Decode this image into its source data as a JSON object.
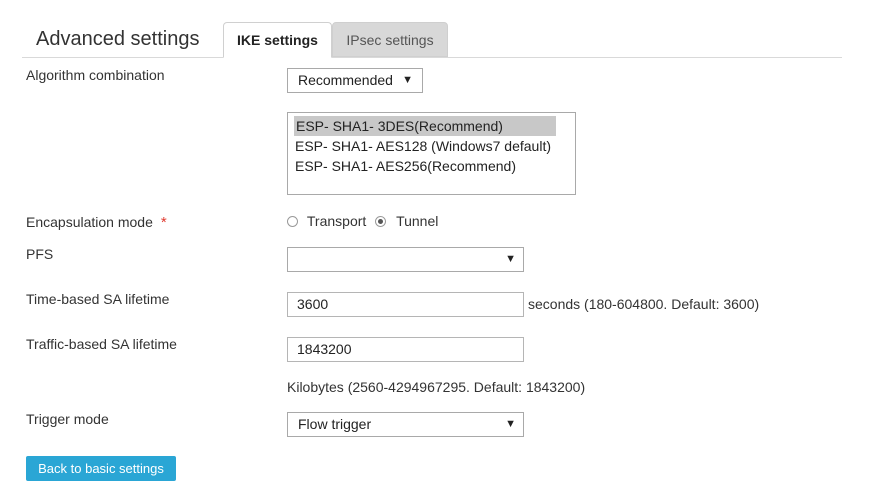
{
  "header": {
    "title": "Advanced settings",
    "tabs": [
      {
        "label": "IKE settings",
        "active": true
      },
      {
        "label": "IPsec settings",
        "active": false
      }
    ]
  },
  "form": {
    "algorithm_combination": {
      "label": "Algorithm combination",
      "value": "Recommended",
      "options_list": [
        "ESP- SHA1- 3DES(Recommend)",
        "ESP- SHA1- AES128 (Windows7 default)",
        "ESP- SHA1- AES256(Recommend)"
      ],
      "selected_index": 0
    },
    "encapsulation_mode": {
      "label": "Encapsulation mode",
      "required_mark": "*",
      "options": [
        "Transport",
        "Tunnel"
      ],
      "selected": "Tunnel"
    },
    "pfs": {
      "label": "PFS",
      "value": ""
    },
    "time_sa_lifetime": {
      "label": "Time-based SA lifetime",
      "value": "3600",
      "hint": "seconds (180-604800. Default: 3600)"
    },
    "traffic_sa_lifetime": {
      "label": "Traffic-based SA lifetime",
      "value": "1843200",
      "hint": "Kilobytes (2560-4294967295. Default: 1843200)"
    },
    "trigger_mode": {
      "label": "Trigger mode",
      "value": "Flow trigger"
    }
  },
  "actions": {
    "back_label": "Back to basic settings"
  },
  "colors": {
    "accent": "#2aa6d5",
    "required": "#e03a2f",
    "tab_inactive_bg": "#d8d8d8"
  }
}
